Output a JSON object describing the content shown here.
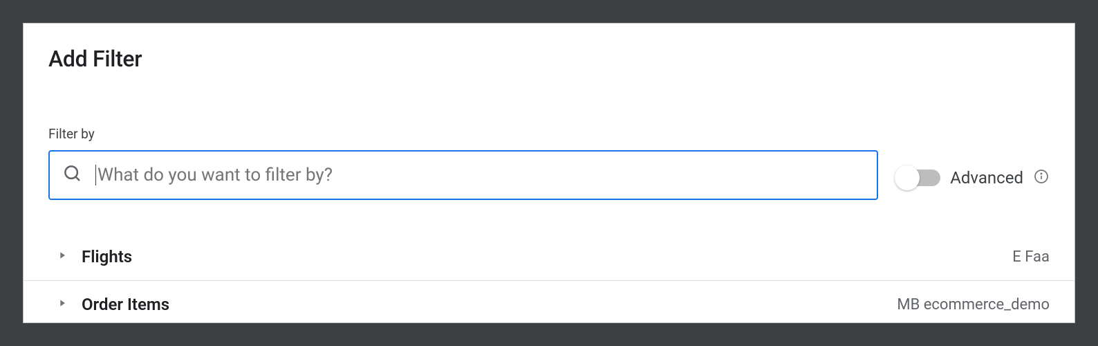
{
  "title": "Add Filter",
  "filter": {
    "label": "Filter by",
    "placeholder": "What do you want to filter by?",
    "value": ""
  },
  "advanced": {
    "label": "Advanced",
    "enabled": false
  },
  "groups": [
    {
      "name": "Flights",
      "source": "E Faa"
    },
    {
      "name": "Order Items",
      "source": "MB ecommerce_demo"
    }
  ]
}
